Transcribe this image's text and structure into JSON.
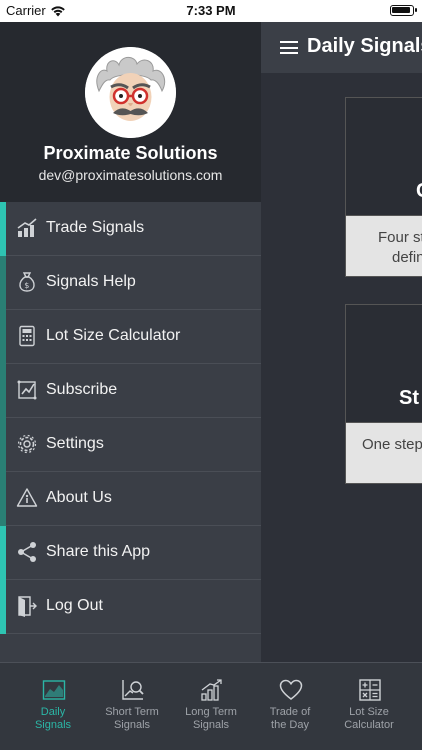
{
  "status_bar": {
    "carrier": "Carrier",
    "time": "7:33 PM"
  },
  "main": {
    "title": "Daily Signals",
    "cards": [
      {
        "heading": "C",
        "text": "Four st",
        "text2": "defin"
      },
      {
        "heading": "St",
        "text": "One step"
      }
    ]
  },
  "drawer": {
    "company": "Proximate Solutions",
    "email": "dev@proximatesolutions.com",
    "menu": [
      {
        "label": "Trade Signals",
        "icon": "bar-chart-icon"
      },
      {
        "label": "Signals Help",
        "icon": "money-bag-icon"
      },
      {
        "label": "Lot Size Calculator",
        "icon": "calculator-icon"
      },
      {
        "label": "Subscribe",
        "icon": "subscribe-icon"
      },
      {
        "label": "Settings",
        "icon": "gear-icon"
      },
      {
        "label": "About Us",
        "icon": "info-icon"
      },
      {
        "label": "Share this App",
        "icon": "share-icon"
      },
      {
        "label": "Log Out",
        "icon": "logout-icon"
      }
    ]
  },
  "tabs": [
    {
      "line1": "Daily",
      "line2": "Signals",
      "icon": "area-chart-icon",
      "active": true
    },
    {
      "line1": "Short Term",
      "line2": "Signals",
      "icon": "chart-search-icon"
    },
    {
      "line1": "Long Term",
      "line2": "Signals",
      "icon": "growth-bars-icon"
    },
    {
      "line1": "Trade of",
      "line2": "the Day",
      "icon": "heart-icon"
    },
    {
      "line1": "Lot Size",
      "line2": "Calculator",
      "icon": "calculator-icon"
    }
  ],
  "colors": {
    "accent": "#2ec4b2",
    "drawer_bg": "#3a3e46",
    "header_bg": "#26292f"
  }
}
